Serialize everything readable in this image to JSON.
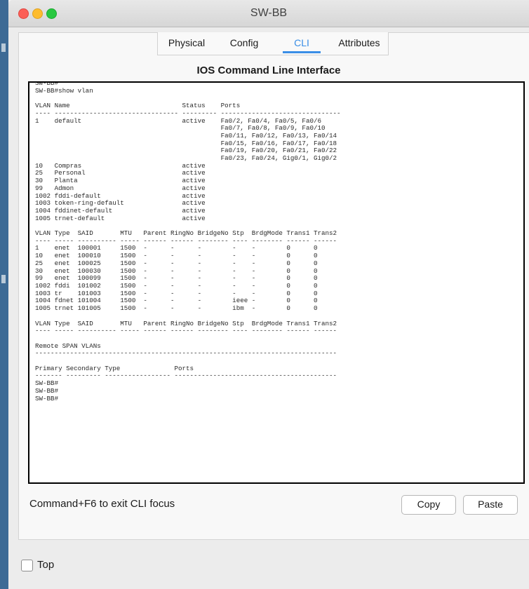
{
  "window": {
    "title": "SW-BB"
  },
  "tabs": [
    {
      "label": "Physical",
      "active": false
    },
    {
      "label": "Config",
      "active": false
    },
    {
      "label": "CLI",
      "active": true
    },
    {
      "label": "Attributes",
      "active": false
    }
  ],
  "cli": {
    "heading": "IOS Command Line Interface",
    "terminal_lines": [
      "SW-BB#",
      "SW-BB#show vlan",
      "",
      "VLAN Name                             Status    Ports",
      "---- -------------------------------- --------- -------------------------------",
      "1    default                          active    Fa0/2, Fa0/4, Fa0/5, Fa0/6",
      "                                                Fa0/7, Fa0/8, Fa0/9, Fa0/10",
      "                                                Fa0/11, Fa0/12, Fa0/13, Fa0/14",
      "                                                Fa0/15, Fa0/16, Fa0/17, Fa0/18",
      "                                                Fa0/19, Fa0/20, Fa0/21, Fa0/22",
      "                                                Fa0/23, Fa0/24, Gig0/1, Gig0/2",
      "10   Compras                          active",
      "25   Personal                         active",
      "30   Planta                           active",
      "99   Admon                            active",
      "1002 fddi-default                     active",
      "1003 token-ring-default               active",
      "1004 fddinet-default                  active",
      "1005 trnet-default                    active",
      "",
      "VLAN Type  SAID       MTU   Parent RingNo BridgeNo Stp  BrdgMode Trans1 Trans2",
      "---- ----- ---------- ----- ------ ------ -------- ---- -------- ------ ------",
      "1    enet  100001     1500  -      -      -        -    -        0      0",
      "10   enet  100010     1500  -      -      -        -    -        0      0",
      "25   enet  100025     1500  -      -      -        -    -        0      0",
      "30   enet  100030     1500  -      -      -        -    -        0      0",
      "99   enet  100099     1500  -      -      -        -    -        0      0",
      "1002 fddi  101002     1500  -      -      -        -    -        0      0",
      "1003 tr    101003     1500  -      -      -        -    -        0      0",
      "1004 fdnet 101004     1500  -      -      -        ieee -        0      0",
      "1005 trnet 101005     1500  -      -      -        ibm  -        0      0",
      "",
      "VLAN Type  SAID       MTU   Parent RingNo BridgeNo Stp  BrdgMode Trans1 Trans2",
      "---- ----- ---------- ----- ------ ------ -------- ---- -------- ------ ------",
      "",
      "Remote SPAN VLANs",
      "------------------------------------------------------------------------------",
      "",
      "Primary Secondary Type              Ports",
      "------- --------- ----------------- ------------------------------------------",
      "SW-BB#",
      "SW-BB#",
      "SW-BB#"
    ]
  },
  "footer": {
    "hint": "Command+F6 to exit CLI focus",
    "copy_label": "Copy",
    "paste_label": "Paste"
  },
  "options": {
    "top_label": "Top",
    "top_checked": false
  }
}
